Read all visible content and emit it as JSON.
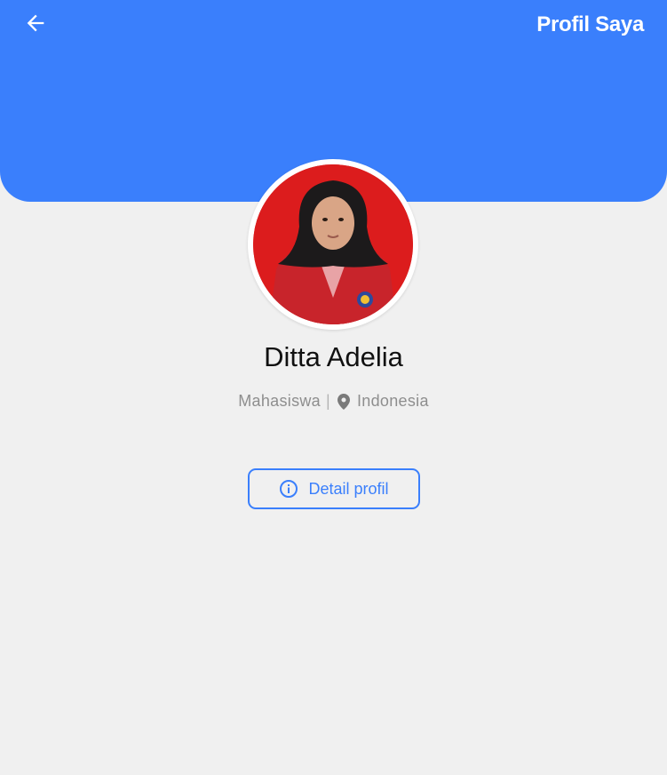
{
  "header": {
    "title": "Profil Saya",
    "back_icon": "arrow-left-icon",
    "background": "#3a7ffc"
  },
  "profile": {
    "avatar_icon": "profile-photo",
    "name": "Ditta Adelia",
    "role": "Mahasiswa",
    "separator": "|",
    "location_icon": "location-pin-icon",
    "location": "Indonesia"
  },
  "actions": {
    "detail_icon": "info-circle-icon",
    "detail_label": "Detail profil"
  },
  "colors": {
    "accent": "#3a7ffc",
    "page_background": "#f0f0f0",
    "muted_text": "#8e8e8e"
  }
}
